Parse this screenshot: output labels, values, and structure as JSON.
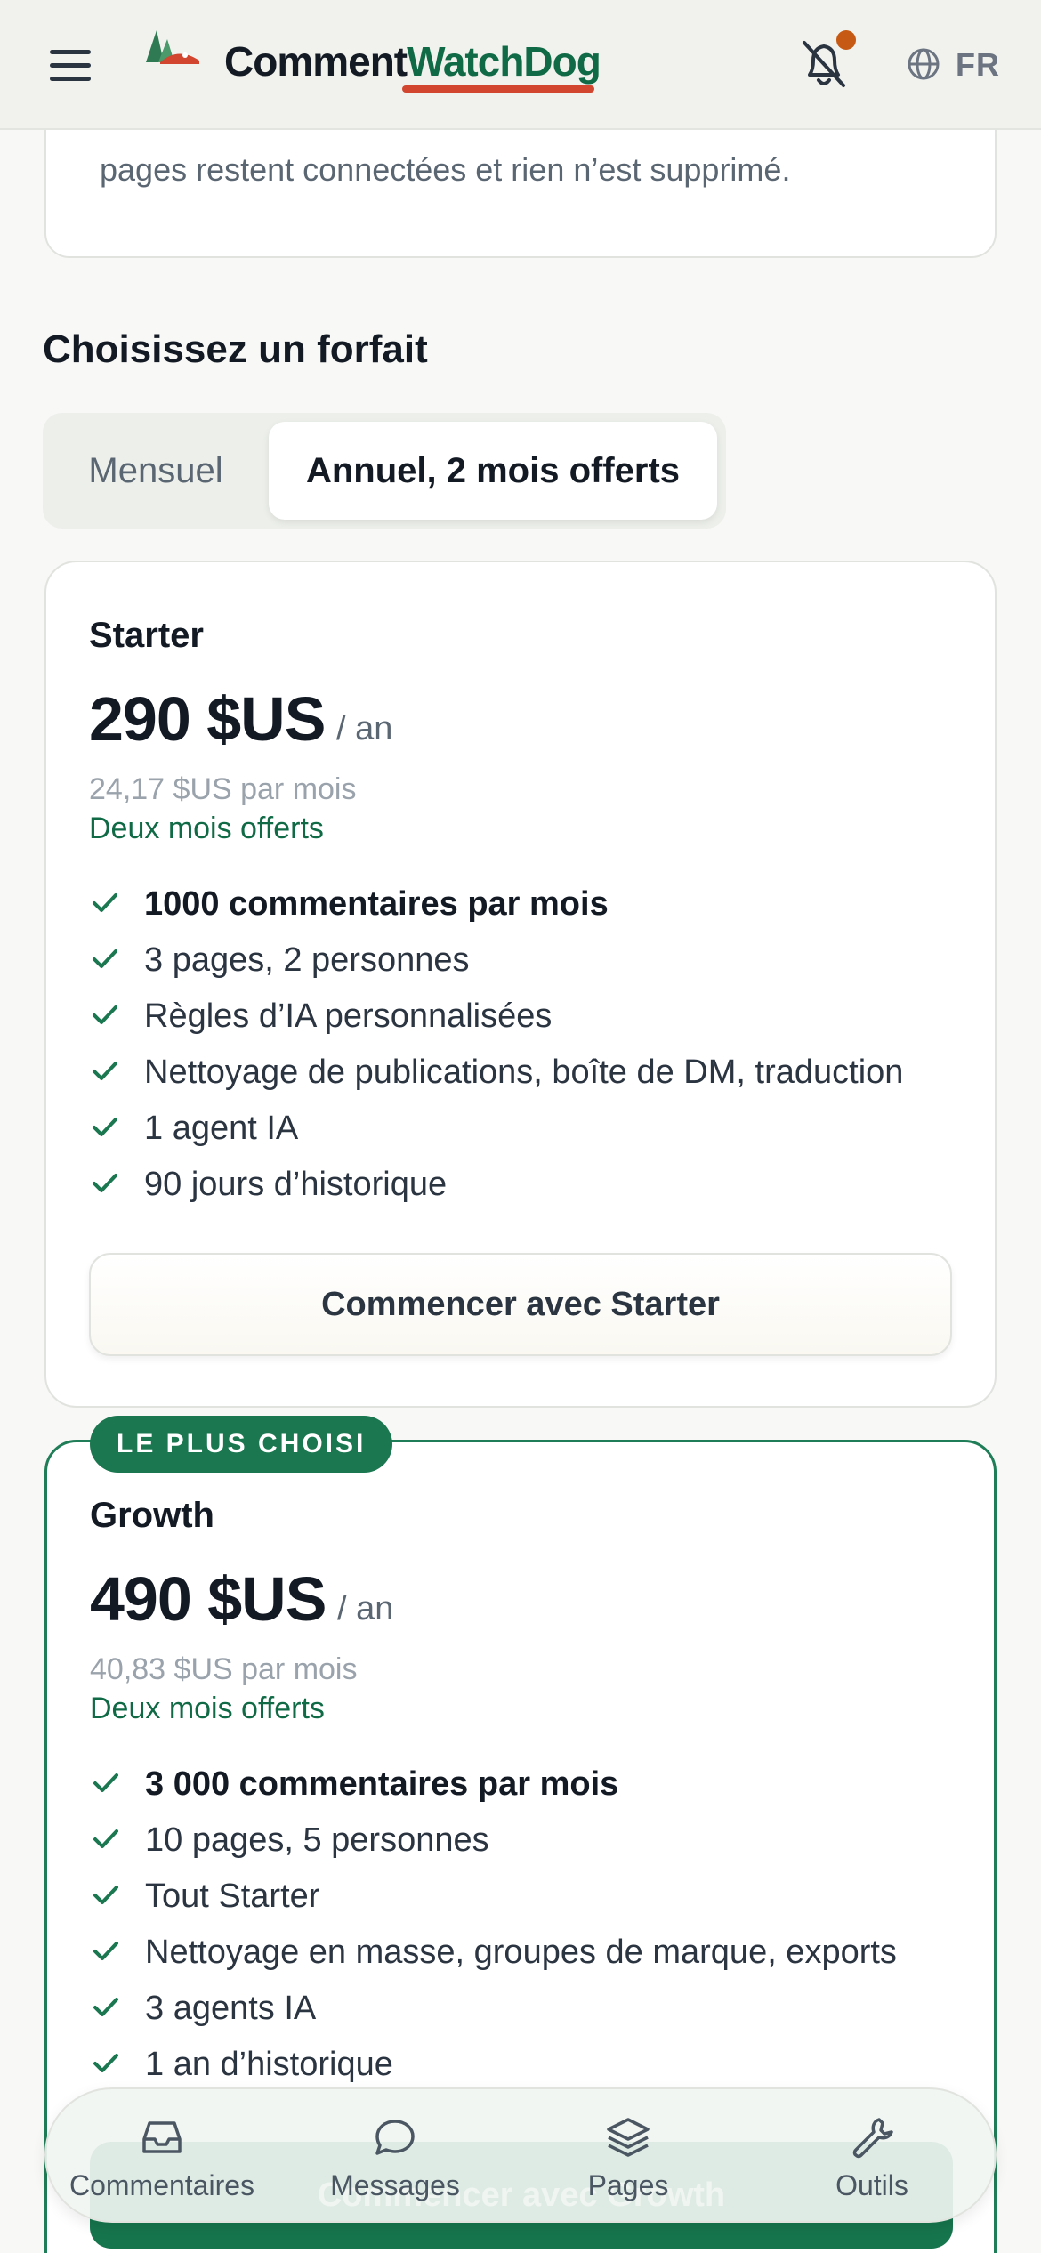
{
  "header": {
    "brand_part1": "Comment",
    "brand_part2": "WatchDog",
    "language": "FR",
    "icons": {
      "menu": "menu-icon",
      "notifications": "bell-off-icon",
      "language": "globe-icon"
    }
  },
  "info_card": {
    "text": "pages restent connectées et rien n’est supprimé."
  },
  "plans_section": {
    "title": "Choisissez un forfait",
    "billing_toggle": {
      "monthly_label": "Mensuel",
      "annual_label": "Annuel, 2 mois offerts",
      "selected": "annual"
    }
  },
  "plans": [
    {
      "name": "Starter",
      "price": "290 $US",
      "period": "/ an",
      "monthly_equivalent": "24,17 $US par mois",
      "promo": "Deux mois offerts",
      "features": [
        "1000 commentaires par mois",
        "3 pages, 2 personnes",
        "Règles d’IA personnalisées",
        "Nettoyage de publications, boîte de DM, traduction",
        "1 agent IA",
        "90 jours d’historique"
      ],
      "cta": "Commencer avec Starter"
    },
    {
      "name": "Growth",
      "badge": "LE PLUS CHOISI",
      "price": "490 $US",
      "period": "/ an",
      "monthly_equivalent": "40,83 $US par mois",
      "promo": "Deux mois offerts",
      "features": [
        "3 000 commentaires par mois",
        "10 pages, 5 personnes",
        "Tout Starter",
        "Nettoyage en masse, groupes de marque, exports",
        "3 agents IA",
        "1 an d’historique"
      ],
      "cta": "Commencer avec Growth"
    }
  ],
  "bottom_nav": [
    {
      "label": "Commentaires",
      "icon": "inbox-icon"
    },
    {
      "label": "Messages",
      "icon": "chat-bubble-icon"
    },
    {
      "label": "Pages",
      "icon": "layers-icon"
    },
    {
      "label": "Outils",
      "icon": "wrench-icon"
    }
  ],
  "colors": {
    "brand_green": "#0f6a45",
    "accent_red": "#d2462f",
    "notification_dot": "#c65a14",
    "primary_button": "#16754d"
  }
}
